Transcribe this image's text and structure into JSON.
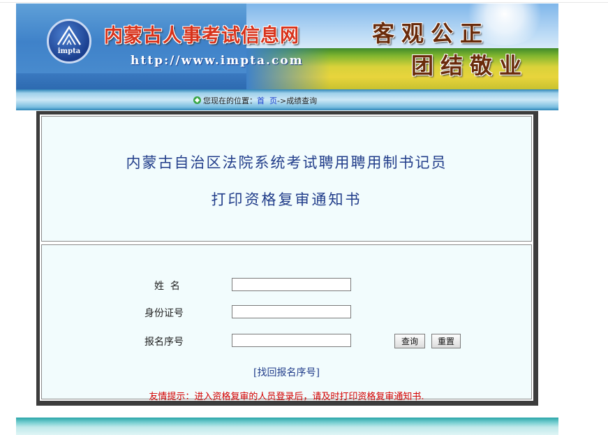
{
  "header": {
    "logo_text": "impta",
    "site_title": "内蒙古人事考试信息网",
    "site_url": "http://www.impta.com",
    "slogan_line1": "客观公正",
    "slogan_line2": "团结敬业"
  },
  "breadcrumb": {
    "icon": "leaf-bullet-icon",
    "prefix": "您现在的位置：",
    "home": "首  页",
    "separator": "->",
    "current": "成绩查询"
  },
  "notice": {
    "title_line1": "内蒙古自治区法院系统考试聘用聘用制书记员",
    "title_line2": "打印资格复审通知书"
  },
  "form": {
    "name_label": "姓  名",
    "name_value": "",
    "id_label": "身份证号",
    "id_value": "",
    "regno_label": "报名序号",
    "regno_value": "",
    "query_button": "查询",
    "reset_button": "重置",
    "recover_link": "[找回报名序号]"
  },
  "tip": "友情提示：进入资格复审的人员登录后，请及时打印资格复审通知书.",
  "colors": {
    "title_blue": "#213d8a",
    "tip_red": "#d40000",
    "panel_border": "#3c3c3c",
    "box_background": "#f2fcfd"
  }
}
